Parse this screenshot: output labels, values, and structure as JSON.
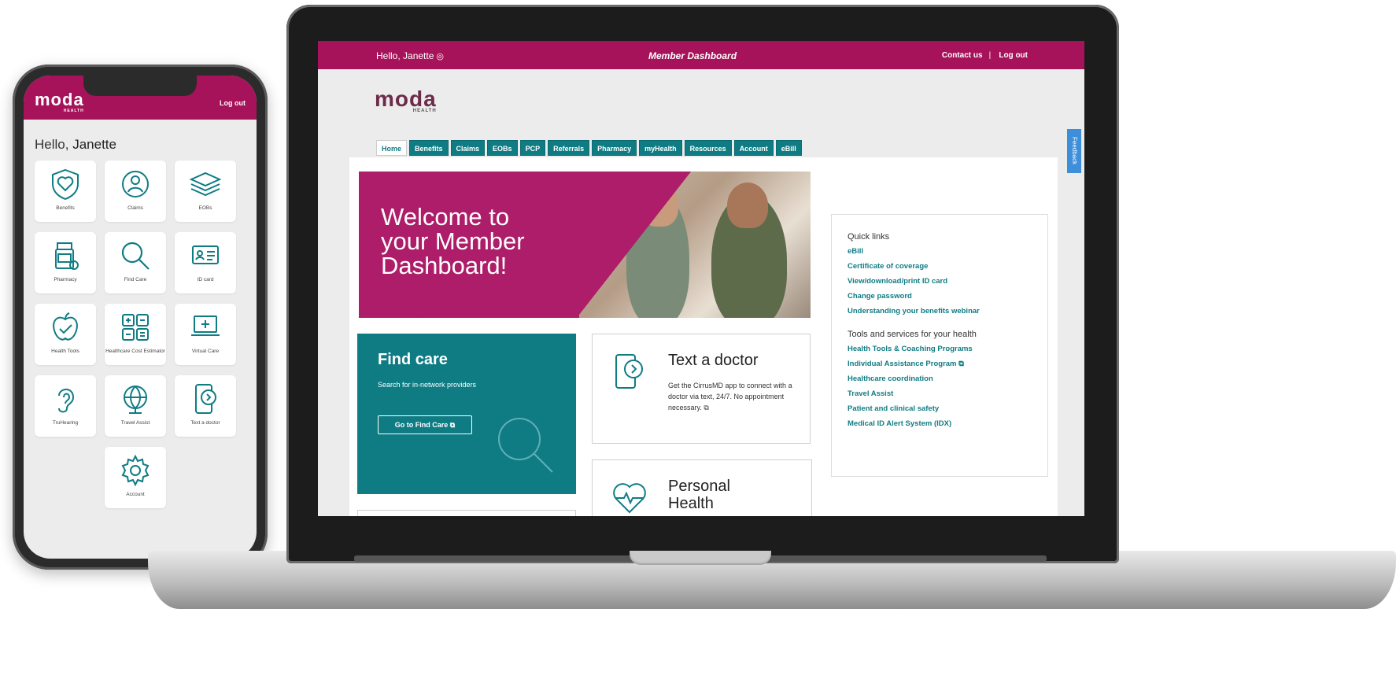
{
  "phone": {
    "logo": "moda",
    "logo_sub": "HEALTH",
    "logout": "Log out",
    "greeting": "Hello,",
    "name": "Janette",
    "tiles": [
      {
        "label": "Benefits",
        "icon": "shield-heart-icon"
      },
      {
        "label": "Claims",
        "icon": "person-cycle-icon"
      },
      {
        "label": "EOBs",
        "icon": "stack-icon"
      },
      {
        "label": "Pharmacy",
        "icon": "pill-bottle-icon"
      },
      {
        "label": "Find Care",
        "icon": "magnifier-icon"
      },
      {
        "label": "ID card",
        "icon": "id-card-icon"
      },
      {
        "label": "Health Tools",
        "icon": "apple-check-icon"
      },
      {
        "label": "Healthcare Cost Estimator",
        "icon": "calculator-icon"
      },
      {
        "label": "Virtual Care",
        "icon": "laptop-medical-icon"
      },
      {
        "label": "TruHearing",
        "icon": "ear-icon"
      },
      {
        "label": "Travel Assist",
        "icon": "globe-icon"
      },
      {
        "label": "Text a doctor",
        "icon": "phone-chat-icon"
      },
      {
        "label": "Account",
        "icon": "gear-icon"
      }
    ]
  },
  "laptop": {
    "topbar": {
      "greeting": "Hello, Janette",
      "title": "Member Dashboard",
      "contact": "Contact us",
      "logout": "Log out"
    },
    "logo": "moda",
    "logo_sub": "HEALTH",
    "tabs": [
      "Home",
      "Benefits",
      "Claims",
      "EOBs",
      "PCP",
      "Referrals",
      "Pharmacy",
      "myHealth",
      "Resources",
      "Account",
      "eBill"
    ],
    "feedback": "Feedback",
    "hero": {
      "text": "Welcome to your Member Dashboard!"
    },
    "find_care": {
      "title": "Find care",
      "desc": "Search for in-network providers",
      "button": "Go to Find Care"
    },
    "text_doctor": {
      "title": "Text a doctor",
      "body": "Get the CirrusMD app to connect with a doctor via text, 24/7. No appointment necessary."
    },
    "pha": {
      "title": "Personal Health"
    },
    "quick_links": {
      "heading": "Quick links",
      "links": [
        "eBill",
        "Certificate of coverage",
        "View/download/print ID card",
        "Change password",
        "Understanding your benefits webinar"
      ]
    },
    "tools": {
      "heading": "Tools and services for your health",
      "links": [
        "Health Tools & Coaching Programs",
        "Individual Assistance Program",
        "Healthcare coordination",
        "Travel Assist",
        "Patient and clinical safety",
        "Medical ID Alert System (IDX)"
      ]
    }
  },
  "colors": {
    "brand": "#a6135a",
    "teal": "#0f7c84"
  }
}
